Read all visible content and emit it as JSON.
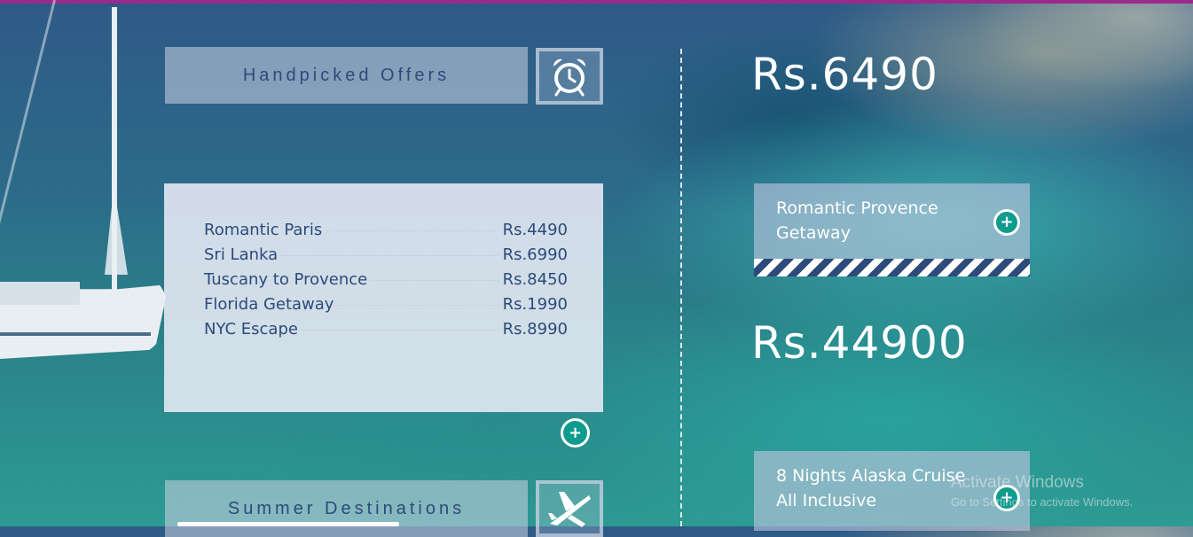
{
  "colors": {
    "accent": "#0f9b8e",
    "title_text": "#2d4a7a",
    "top_bar": "#9b2a8c"
  },
  "left": {
    "offers_title": "Handpicked Offers",
    "offers_icon": "alarm-clock-icon",
    "list": [
      {
        "name": "Romantic Paris",
        "price": "Rs.4490"
      },
      {
        "name": "Sri Lanka",
        "price": "Rs.6990"
      },
      {
        "name": "Tuscany to Provence",
        "price": "Rs.8450"
      },
      {
        "name": "Florida Getaway",
        "price": "Rs.1990"
      },
      {
        "name": "NYC Escape",
        "price": "Rs.8990"
      }
    ],
    "plus_label": "+",
    "summer_title": "Summer Destinations",
    "summer_icon": "airplane-icon"
  },
  "right": {
    "price_1": "Rs.6490",
    "card_1": {
      "line1": "Romantic Provence",
      "line2": "Getaway",
      "plus": "+"
    },
    "price_2": "Rs.44900",
    "card_2": {
      "line1": "8 Nights Alaska Cruise",
      "line2": "All Inclusive",
      "plus": "+"
    }
  },
  "watermark": {
    "title": "Activate Windows",
    "subtitle": "Go to Settings to activate Windows."
  }
}
